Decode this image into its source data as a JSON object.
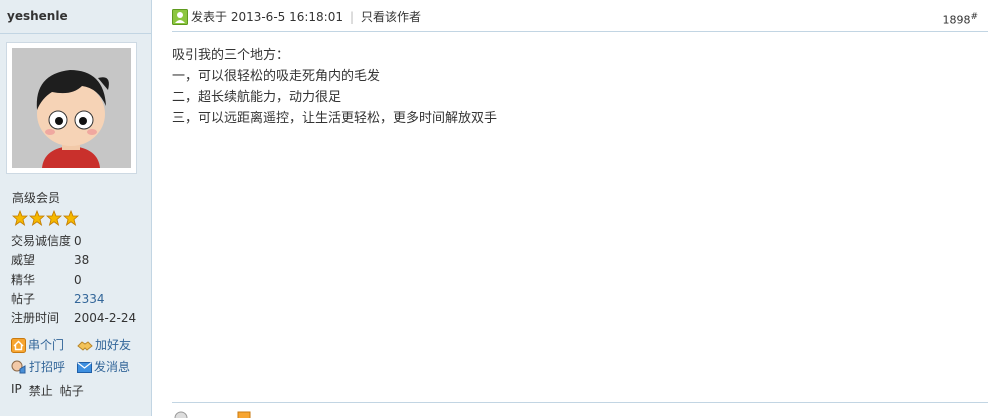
{
  "user": {
    "name": "yeshenle",
    "group": "高级会员",
    "stars": 4,
    "stats": [
      {
        "label": "交易诚信度",
        "value": "0"
      },
      {
        "label": "威望",
        "value": "38"
      },
      {
        "label": "精华",
        "value": "0"
      },
      {
        "label": "帖子",
        "value": "2334"
      },
      {
        "label": "注册时间",
        "value": "2004-2-24"
      }
    ],
    "actions": [
      {
        "label": "串个门",
        "icon": "home-icon"
      },
      {
        "label": "加好友",
        "icon": "handshake-icon"
      },
      {
        "label": "打招呼",
        "icon": "greet-icon"
      },
      {
        "label": "发消息",
        "icon": "mail-icon"
      }
    ],
    "admin_links": [
      "IP",
      "禁止",
      "帖子"
    ]
  },
  "post": {
    "posted_at": "发表于 2013-6-5 16:18:01",
    "only_author": "只看该作者",
    "floor_number": "1898",
    "floor_mark": "#",
    "lines": [
      "吸引我的三个地方：",
      "一，可以很轻松的吸走死角内的毛发",
      "二，超长续航能力，动力很足",
      "三，可以远距离遥控，让生活更轻松，更多时间解放双手"
    ]
  },
  "colors": {
    "sidebar_bg": "#e5edf2",
    "border": "#c2d5e3",
    "link": "#336699",
    "star": "#f5b800",
    "online": "#7fbf3f"
  }
}
